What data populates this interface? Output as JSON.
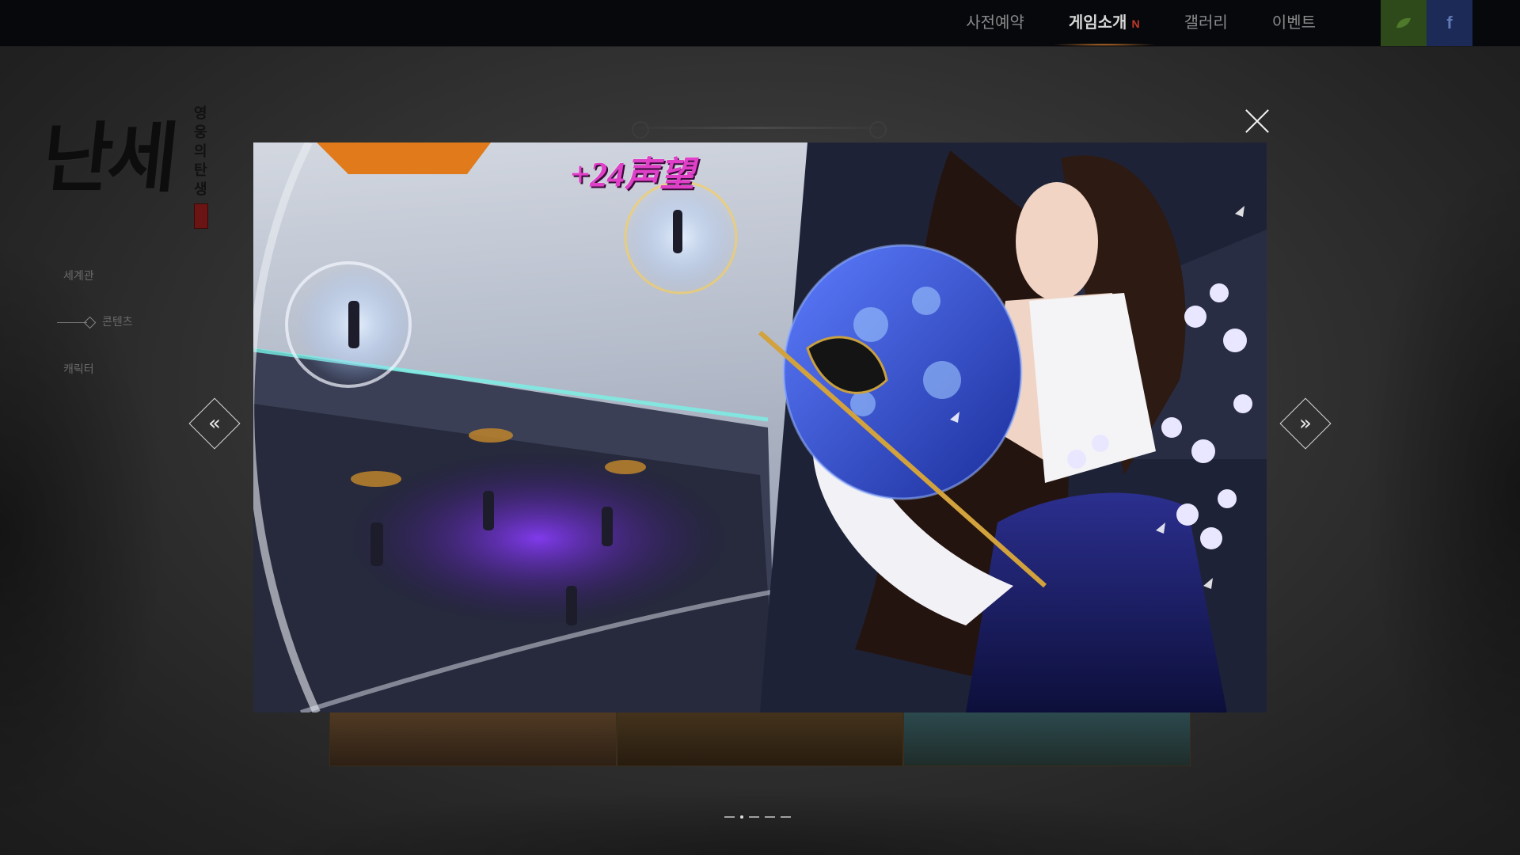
{
  "nav": {
    "items": [
      {
        "label": "사전예약",
        "active": false
      },
      {
        "label": "게임소개",
        "active": true,
        "badge": "N"
      },
      {
        "label": "갤러리",
        "active": false
      },
      {
        "label": "이벤트",
        "active": false
      }
    ],
    "social": [
      {
        "icon": "leaf-icon",
        "color": "#2e4a1a"
      },
      {
        "icon": "facebook-icon",
        "label": "f",
        "color": "#1b2a57"
      }
    ]
  },
  "logo": {
    "main": "난세",
    "sub": "영웅의탄생"
  },
  "side_menu": {
    "items": [
      "세계관",
      "콘텐츠",
      "캐릭터"
    ],
    "active_index": 1
  },
  "slide": {
    "score_text": "+24声望"
  },
  "controls": {
    "close_icon": "close-icon",
    "prev_icon": "chevron-left-icon",
    "prev_glyph": "«",
    "next_icon": "chevron-right-icon",
    "next_glyph": "»"
  },
  "pager": {
    "count": 5,
    "active_index": 1
  },
  "colors": {
    "accent": "#c9772c",
    "badge": "#c0392b",
    "score": "#e040c8"
  }
}
